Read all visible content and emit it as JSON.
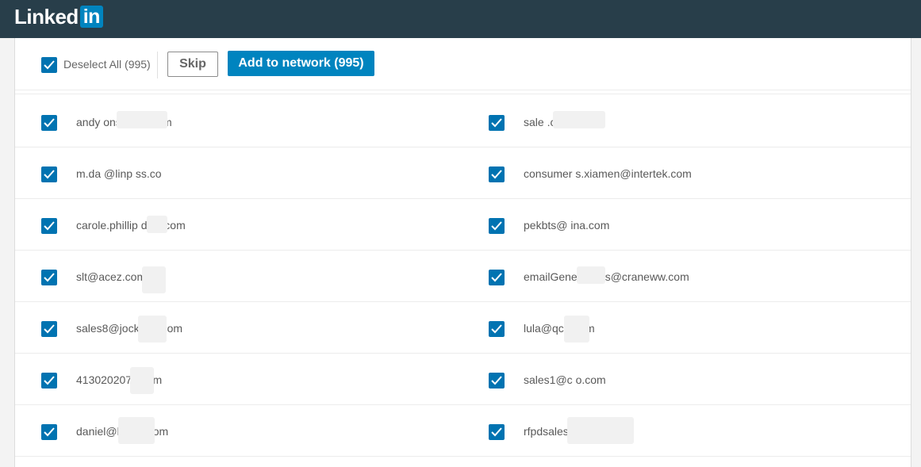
{
  "brand": {
    "logo_text": "Linked",
    "logo_box_text": "in"
  },
  "toolbar": {
    "deselect_label": "Deselect All (995)",
    "skip_label": "Skip",
    "add_label": "Add to network (995)"
  },
  "contacts": [
    {
      "left": "andy             onsulting.com",
      "right": "sale              .com"
    },
    {
      "left": "m.da     @linp          ss.co",
      "right": "consumer        s.xiamen@intertek.com"
    },
    {
      "left": "carole.phillip        dinc.com",
      "right": "pekbts@          ina.com"
    },
    {
      "left": "slt@acez.com",
      "right": "emailGener        uiries@craneww.com"
    },
    {
      "left": "sales8@jock-        ng.com",
      "right": "lula@qc-        .com"
    },
    {
      "left": "4130202076       com",
      "right": "sales1@c         o.com"
    },
    {
      "left": "daniel@h         ech.com",
      "right": "rfpdsales              rfpd.com"
    }
  ],
  "colors": {
    "topbar": "#283e4a",
    "accent": "#0084bf",
    "checkbox": "#0073b1"
  }
}
